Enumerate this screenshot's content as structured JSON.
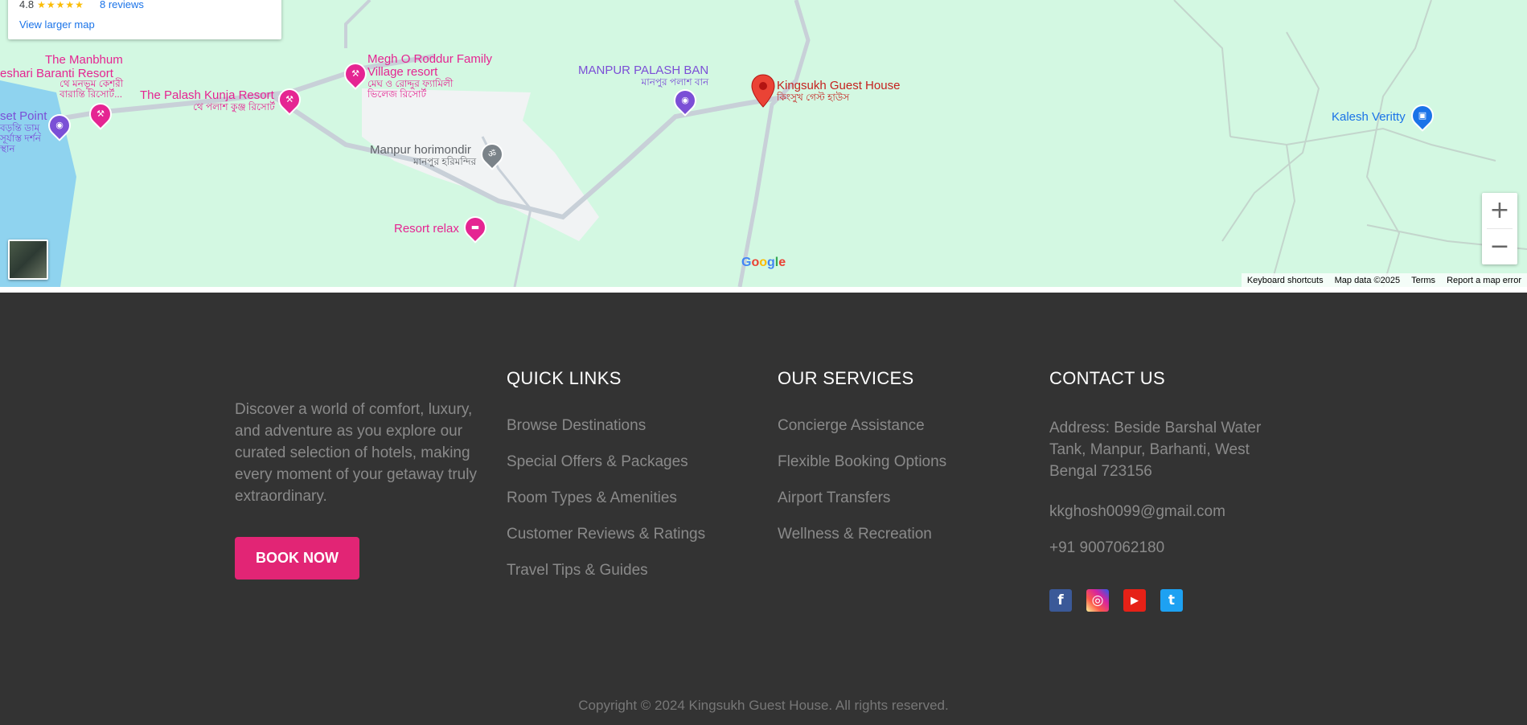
{
  "map": {
    "card": {
      "rating": "4.8",
      "stars": "★★★★★",
      "reviews": "8 reviews",
      "view_larger": "View larger map"
    },
    "pois": [
      {
        "id": "manbhum",
        "label": "The Manbhum",
        "sub": "",
        "color": "#e52592"
      },
      {
        "id": "keshari",
        "label": "eshari Baranti Resort",
        "sub": "থে মনভূম কেশরী বারান্তি রিসোর্ট...",
        "color": "#e52592"
      },
      {
        "id": "sunset",
        "label": "set Point",
        "sub": "বড়ন্তি ডাম্ সূর্যাস্ত দর্শন স্থান",
        "color": "#7b4fd6"
      },
      {
        "id": "palash-kunja",
        "label": "The Palash Kunja Resort",
        "sub": "থে পলাশ কুঞ্জ রিসোর্ট",
        "color": "#e52592"
      },
      {
        "id": "megh",
        "label": "Megh O Roddur Family Village resort",
        "sub": "মেঘ ও রোদ্দুর ফ্যামিলী ভিলেজ রিসোর্ট",
        "color": "#e52592"
      },
      {
        "id": "manpur-palash",
        "label": "MANPUR PALASH BAN",
        "sub": "মানপুর পলাশ বান",
        "color": "#7b4fd6"
      },
      {
        "id": "kingsukh",
        "label": "Kingsukh Guest House",
        "sub": "কিংসুখ গেস্ট হাউস",
        "color": "#c5221f"
      },
      {
        "id": "horimondir",
        "label": "Manpur horimondir",
        "sub": "মানপুর হরিমন্দির",
        "color": "#5f6368"
      },
      {
        "id": "resort-relax",
        "label": "Resort relax",
        "sub": "",
        "color": "#e52592"
      },
      {
        "id": "kalesh",
        "label": "Kalesh Veritty",
        "sub": "",
        "color": "#1a73e8"
      }
    ],
    "icons": {
      "resort": "resort-icon",
      "camera": "camera-icon",
      "temple": "temple-icon",
      "hotel": "hotel-icon",
      "shopping": "shopping-bag-icon",
      "marker": "map-marker-icon"
    },
    "zoom_in": "+",
    "zoom_out": "−",
    "google_logo": {
      "letters": [
        "G",
        "o",
        "o",
        "g",
        "l",
        "e"
      ],
      "colors": [
        "#4285f4",
        "#ea4335",
        "#fbbc05",
        "#4285f4",
        "#34a853",
        "#ea4335"
      ]
    },
    "attribution": {
      "shortcuts": "Keyboard shortcuts",
      "data": "Map data ©2025",
      "terms": "Terms",
      "report": "Report a map error"
    }
  },
  "footer": {
    "about": "Discover a world of comfort, luxury, and adventure as you explore our curated selection of hotels, making every moment of your getaway truly extraordinary.",
    "book_now": "BOOK NOW",
    "quick_links": {
      "heading": "QUICK LINKS",
      "items": [
        "Browse Destinations",
        "Special Offers & Packages",
        "Room Types & Amenities",
        "Customer Reviews & Ratings",
        "Travel Tips & Guides"
      ]
    },
    "services": {
      "heading": "OUR SERVICES",
      "items": [
        "Concierge Assistance",
        "Flexible Booking Options",
        "Airport Transfers",
        "Wellness & Recreation"
      ]
    },
    "contact": {
      "heading": "CONTACT US",
      "address": "Address: Beside Barshal Water Tank, Manpur, Barhanti, West Bengal 723156",
      "email": "kkghosh0099@gmail.com",
      "phone": "+91 9007062180"
    },
    "social": [
      {
        "name": "facebook",
        "glyph": "f",
        "color": "#3b5998"
      },
      {
        "name": "instagram",
        "glyph": "◎",
        "color": "#d6249f"
      },
      {
        "name": "youtube",
        "glyph": "▶",
        "color": "#e62117"
      },
      {
        "name": "twitter",
        "glyph": "t",
        "color": "#1da1f2"
      }
    ],
    "copyright": "Copyright © 2024 Kingsukh Guest House. All rights reserved.",
    "colors": {
      "accent": "#e22575",
      "background": "#333333",
      "muted_text": "#8a8a8a"
    }
  }
}
